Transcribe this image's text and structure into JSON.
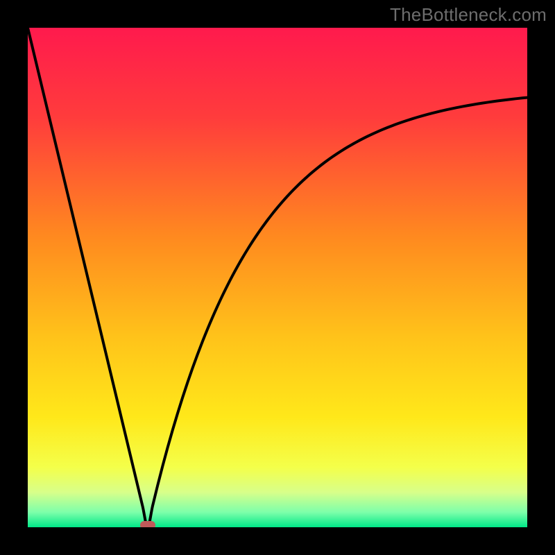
{
  "attribution": "TheBottleneck.com",
  "colors": {
    "frame": "#000000",
    "curve": "#000000",
    "marker": "#bf5a5a",
    "gradient_stops": [
      {
        "pct": 0,
        "color": "#ff1a4d"
      },
      {
        "pct": 18,
        "color": "#ff3c3c"
      },
      {
        "pct": 42,
        "color": "#ff8a1f"
      },
      {
        "pct": 62,
        "color": "#ffc31a"
      },
      {
        "pct": 78,
        "color": "#ffe81a"
      },
      {
        "pct": 88,
        "color": "#f4ff4a"
      },
      {
        "pct": 93,
        "color": "#d8ff8a"
      },
      {
        "pct": 97,
        "color": "#7dffaa"
      },
      {
        "pct": 100,
        "color": "#00e888"
      }
    ]
  },
  "chart_data": {
    "type": "line",
    "title": "",
    "xlabel": "",
    "ylabel": "",
    "xlim": [
      0,
      100
    ],
    "ylim": [
      0,
      100
    ],
    "grid": false,
    "legend": false,
    "min_point": {
      "x": 24,
      "y": 0
    },
    "series": [
      {
        "name": "bottleneck-curve",
        "x": [
          0,
          4,
          8,
          12,
          16,
          20,
          24,
          26,
          28,
          30,
          34,
          38,
          42,
          46,
          50,
          55,
          60,
          65,
          70,
          75,
          80,
          85,
          90,
          95,
          100
        ],
        "y": [
          100,
          83,
          66,
          50,
          33,
          16,
          0,
          6,
          12,
          18,
          28,
          37,
          45,
          52,
          58,
          64,
          69,
          73,
          77,
          80,
          82,
          84,
          86,
          87,
          88
        ]
      }
    ],
    "annotations": [
      {
        "text": "TheBottleneck.com",
        "position": "top-right"
      }
    ]
  }
}
